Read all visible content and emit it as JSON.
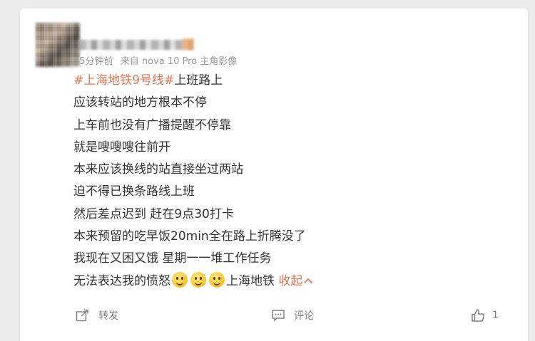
{
  "post": {
    "meta": {
      "time": "35分钟前",
      "source": "来自 nova 10 Pro 主角影像"
    },
    "hashtag": "#上海地铁9号线#",
    "first_line_rest": "上班路上",
    "lines": [
      "应该转站的地方根本不停",
      "上车前也没有广播提醒不停靠",
      "就是嗖嗖嗖往前开",
      "本来应该换线的站直接坐过两站",
      "迫不得已换条路线上班",
      "然后差点迟到 赶在9点30打卡",
      "本来预留的吃早饭20min全在路上折腾没了",
      "我现在又困又饿 星期一一堆工作任务"
    ],
    "last_line_text": "无法表达我的愤怒",
    "last_line_tail": "上海地铁",
    "collapse_label": "收起",
    "collapse_icon": "chevron-up-icon",
    "emoji_name": "smile-emoji"
  },
  "footer": {
    "repost_label": "转发",
    "repost_icon": "share-icon",
    "comment_label": "评论",
    "comment_icon": "comment-icon",
    "like_count": "1",
    "like_icon": "thumbs-up-icon"
  },
  "colors": {
    "accent": "#eb7350",
    "text": "#333333",
    "meta": "#999999",
    "background": "#ebebeb"
  }
}
